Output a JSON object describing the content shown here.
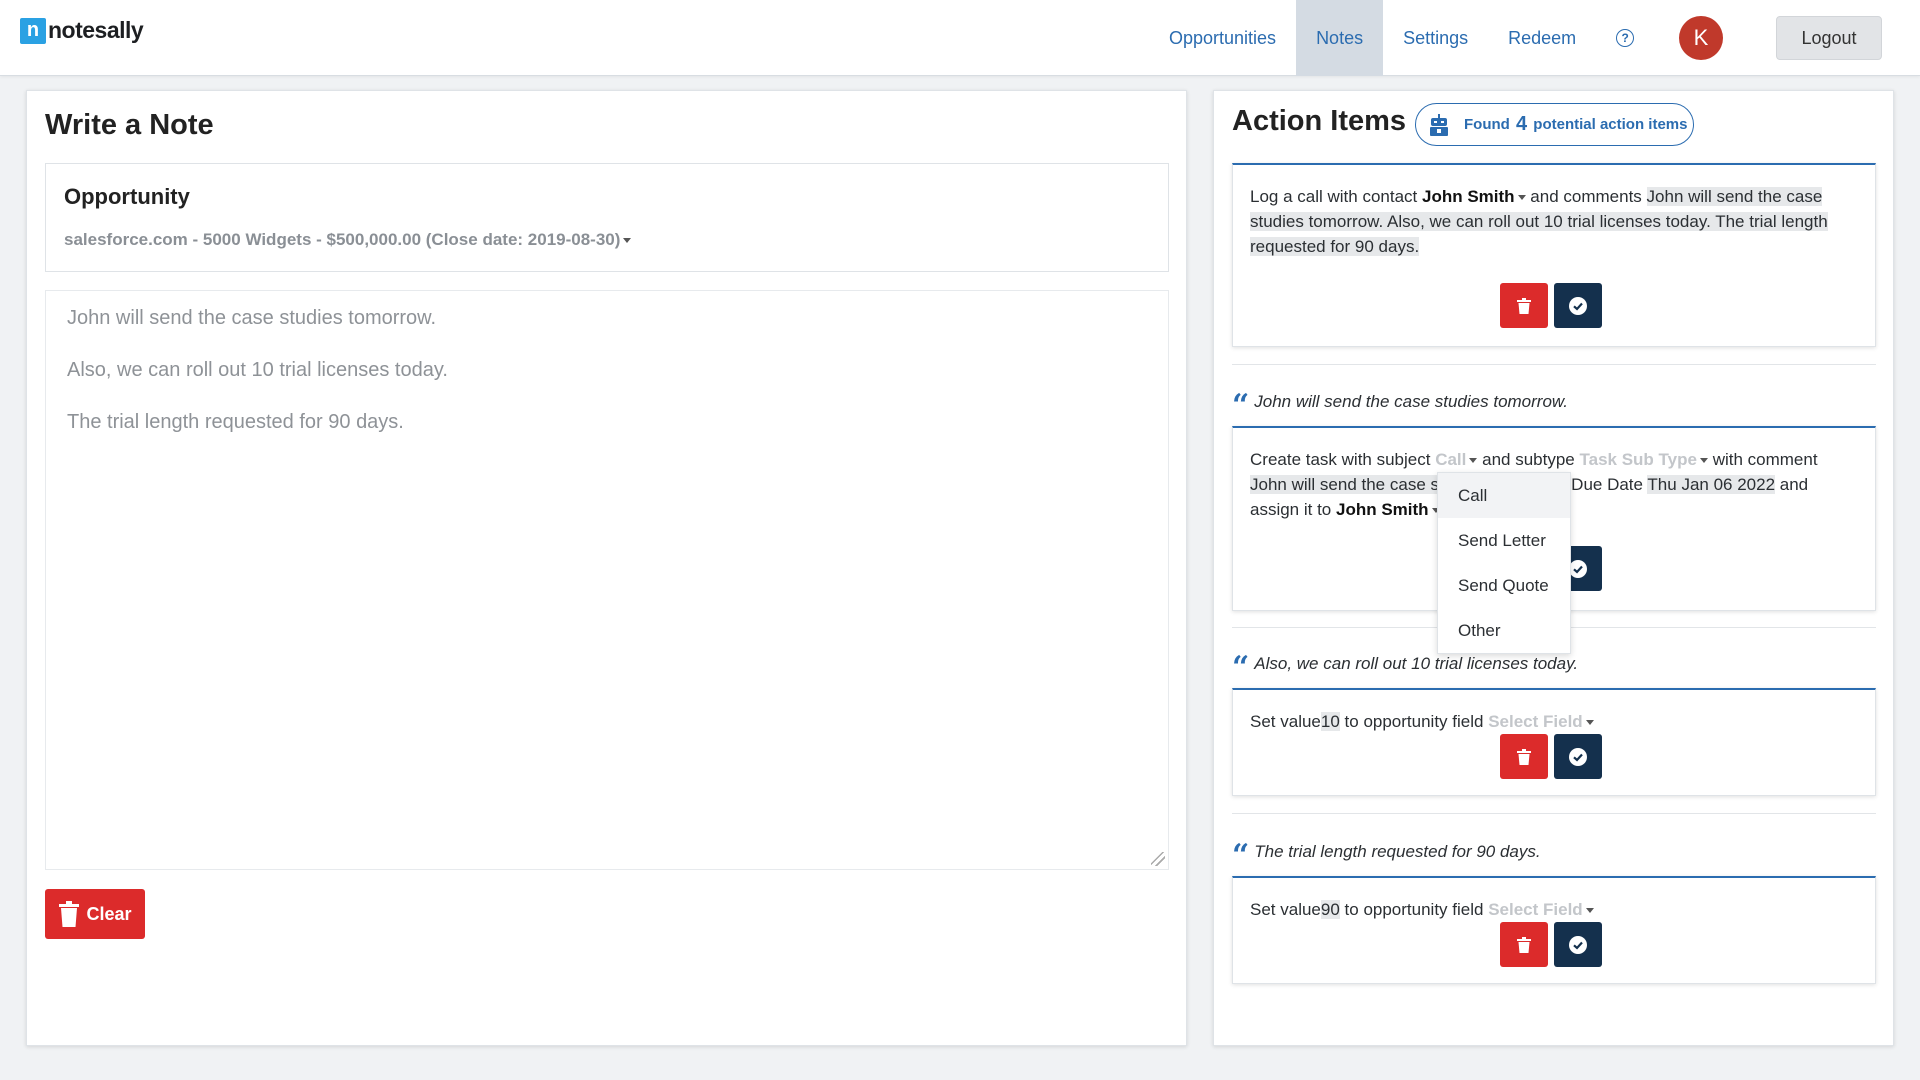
{
  "brand": {
    "logo_letter": "n",
    "name": "notesally"
  },
  "nav": {
    "items": [
      {
        "label": "Opportunities",
        "active": false
      },
      {
        "label": "Notes",
        "active": true
      },
      {
        "label": "Settings",
        "active": false
      },
      {
        "label": "Redeem",
        "active": false
      }
    ],
    "help_symbol": "?",
    "avatar_initial": "K",
    "logout_label": "Logout"
  },
  "note": {
    "title": "Write a Note",
    "opportunity_label": "Opportunity",
    "opportunity_value": "salesforce.com - 5000 Widgets - $500,000.00 (Close date: 2019-08-30)",
    "lines": [
      "John will send the case studies tomorrow.",
      "Also, we can roll out 10 trial licenses today.",
      "The trial length requested for 90 days."
    ],
    "clear_label": "Clear"
  },
  "actions": {
    "title": "Action Items",
    "badge_prefix": "Found",
    "badge_count": "4",
    "badge_suffix": "potential action items",
    "card1": {
      "prefix": "Log a call with contact",
      "contact": "John Smith",
      "mid": "and comments",
      "comments_line1": "John will send the case",
      "comments_line2": "studies tomorrow. Also, we can roll out 10 trial licenses today. The trial length",
      "comments_line3": "requested for 90 days."
    },
    "quote1": "John will send the case studies tomorrow.",
    "card2": {
      "prefix": "Create task with subject",
      "subject": "Call",
      "mid": "and subtype",
      "subtype": "Task Sub Type",
      "suffix": "with comment",
      "comment": "John will send the case s",
      "ellipsis": "., Due Date",
      "due_date": "Thu Jan 06 2022",
      "and": "and",
      "assign_prefix": "assign it to",
      "assignee": "John Smith"
    },
    "quote2": "Also, we can roll out 10 trial licenses today.",
    "card3": {
      "prefix": "Set value",
      "value": "10",
      "mid": "to opportunity field",
      "field": "Select Field"
    },
    "quote3": "The trial length requested for 90 days.",
    "card4": {
      "prefix": "Set value",
      "value": "90",
      "mid": "to opportunity field",
      "field": "Select Field"
    }
  },
  "subject_dropdown": {
    "options": [
      "Call",
      "Send Letter",
      "Send Quote",
      "Other"
    ],
    "highlighted": "Call"
  },
  "colors": {
    "primary": "#2b6cb0",
    "danger": "#dc2b2b",
    "confirm": "#14304d",
    "avatar": "#c0392b"
  }
}
